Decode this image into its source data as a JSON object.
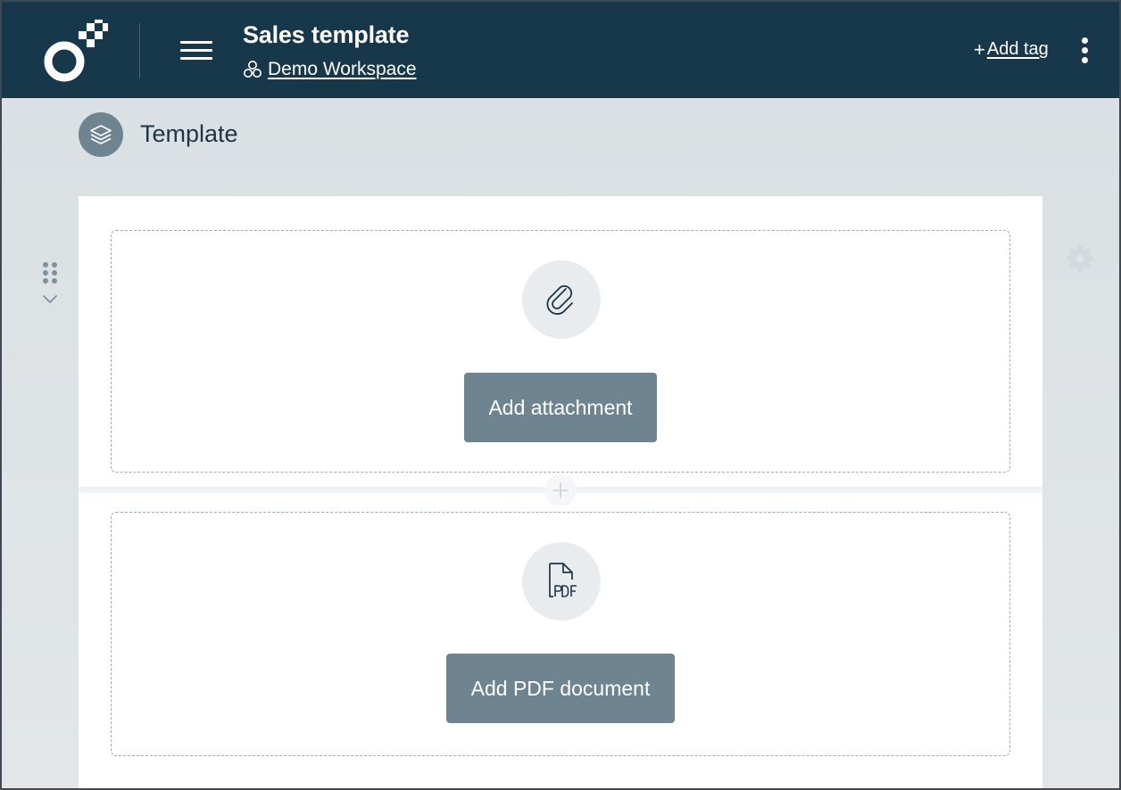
{
  "header": {
    "document_title": "Sales template",
    "workspace_label": "Demo Workspace",
    "add_tag_plus": "+",
    "add_tag_label": "Add tag"
  },
  "section": {
    "title": "Template"
  },
  "blocks": [
    {
      "icon": "paperclip-icon",
      "button_label": "Add attachment"
    },
    {
      "icon": "pdf-file-icon",
      "button_label": "Add PDF document"
    }
  ],
  "colors": {
    "header_bg": "#17374a",
    "button_bg": "#6e8591",
    "icon_circle_bg": "#e8ecef"
  }
}
